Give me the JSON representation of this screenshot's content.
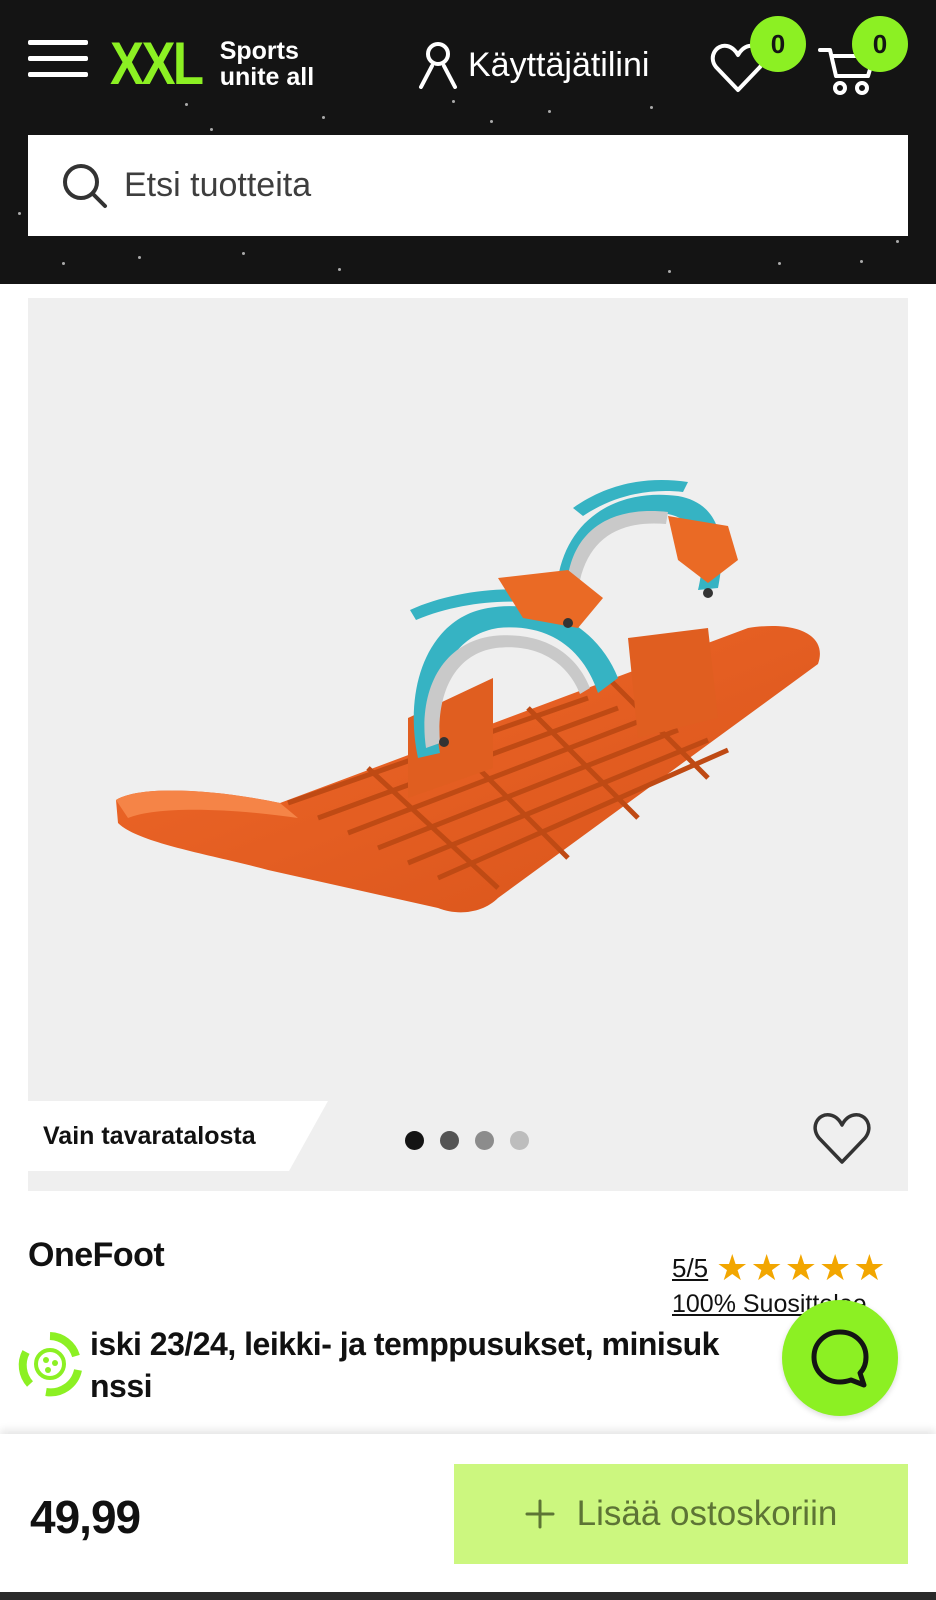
{
  "header": {
    "logo_text": "XXL",
    "logo_tagline_1": "Sports",
    "logo_tagline_2": "unite all",
    "account_label": "Käyttäjätilini",
    "wishlist_count": "0",
    "cart_count": "0",
    "accent_color": "#8cf023",
    "icons": [
      "menu-icon",
      "user-icon",
      "heart-icon",
      "cart-icon"
    ]
  },
  "search": {
    "placeholder": "Etsi tuotteita",
    "icon": "search-icon"
  },
  "gallery": {
    "badge_label": "Vain tavaratalosta",
    "dot_count": 4,
    "active_dot": 0,
    "favorite_icon": "heart-outline-icon"
  },
  "product": {
    "brand": "OneFoot",
    "rating": "5/5",
    "star_count": 5,
    "recommendation": "100% Suosittelee",
    "title_line_1": "iski 23/24, leikki- ja temppusukset, minisuk",
    "title_line_2": "nssi"
  },
  "purchase": {
    "price": "49,99",
    "add_to_cart_label": "Lisää ostoskoriin",
    "button_color": "#ccf77f"
  }
}
